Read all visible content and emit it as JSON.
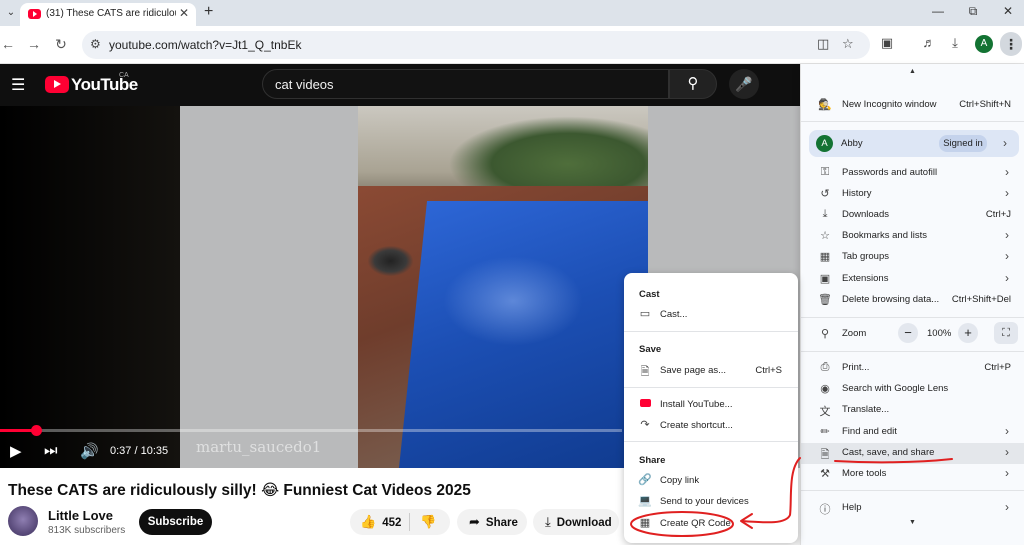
{
  "browser": {
    "tab_title": "(31) These CATS are ridiculously silly! 😂 Funniest Cat Videos 2025",
    "url": "youtube.com/watch?v=Jt1_Q_tnbEk",
    "profile_initial": "A"
  },
  "youtube": {
    "logo_text": "YouTube",
    "region": "CA",
    "search_query": "cat videos",
    "watermark": "martu_saucedo1",
    "time": "0:37 / 10:35",
    "progress_fraction": 0.058,
    "video_title": "These CATS are ridiculously silly! 😂 Funniest Cat Videos 2025",
    "channel_name": "Little Love",
    "subscribers": "813K subscribers",
    "subscribe_label": "Subscribe",
    "like_count": "452",
    "share_label": "Share",
    "download_label": "Download"
  },
  "menu": {
    "incognito": {
      "label": "New Incognito window",
      "shortcut": "Ctrl+Shift+N"
    },
    "profile": {
      "initial": "A",
      "name": "Abby",
      "status": "Signed in"
    },
    "passwords": "Passwords and autofill",
    "history": "History",
    "downloads": {
      "label": "Downloads",
      "shortcut": "Ctrl+J"
    },
    "bookmarks": "Bookmarks and lists",
    "tab_groups": "Tab groups",
    "extensions": "Extensions",
    "delete_data": {
      "label": "Delete browsing data...",
      "shortcut": "Ctrl+Shift+Del"
    },
    "zoom": {
      "label": "Zoom",
      "value": "100%"
    },
    "print": {
      "label": "Print...",
      "shortcut": "Ctrl+P"
    },
    "lens": "Search with Google Lens",
    "translate": "Translate...",
    "find_edit": "Find and edit",
    "cast_save_share": "Cast, save, and share",
    "more_tools": "More tools",
    "help": "Help"
  },
  "submenu": {
    "cast_header": "Cast",
    "cast": "Cast...",
    "save_header": "Save",
    "save_page": {
      "label": "Save page as...",
      "shortcut": "Ctrl+S"
    },
    "install": "Install YouTube...",
    "shortcut": "Create shortcut...",
    "share_header": "Share",
    "copy_link": "Copy link",
    "send_devices": "Send to your devices",
    "qr_code": "Create QR Code"
  },
  "colors": {
    "annotation": "#e02020",
    "youtube_red": "#ff0033",
    "profile_green": "#137333"
  }
}
